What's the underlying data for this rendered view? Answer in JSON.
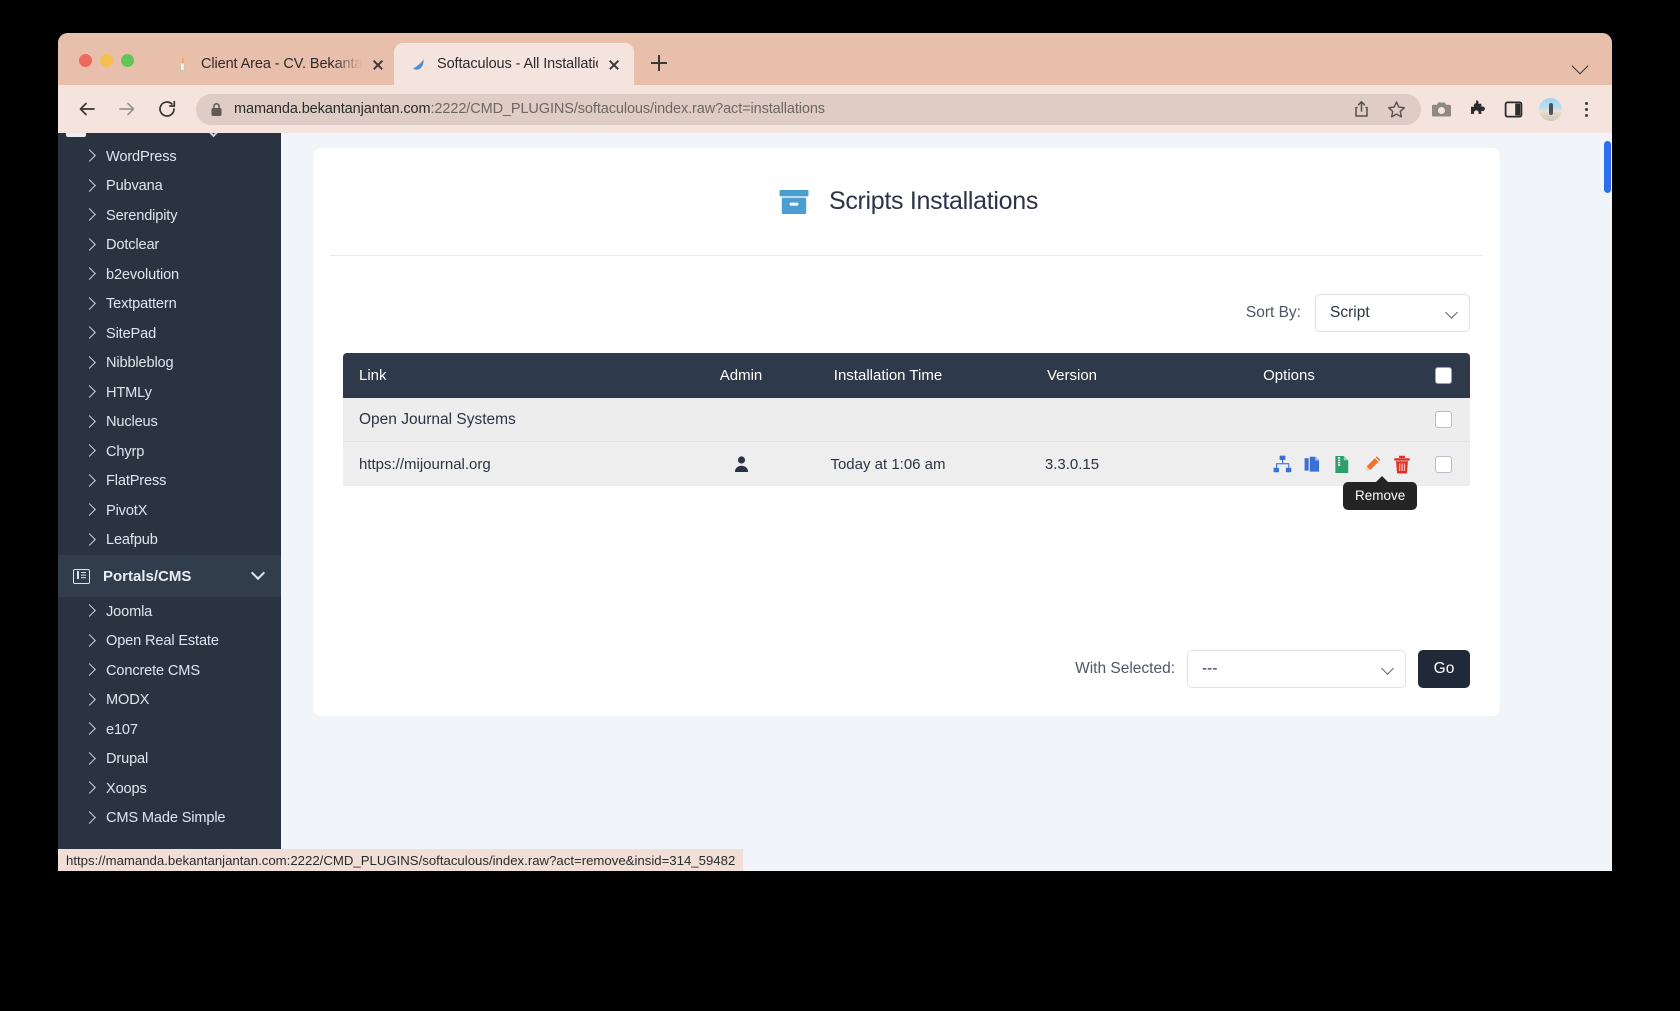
{
  "browser": {
    "tabs": [
      {
        "title": "Client Area - CV. Bekantan Jan",
        "favicon": "candle-icon",
        "active": false
      },
      {
        "title": "Softaculous - All Installations",
        "favicon": "softaculous-icon",
        "active": true
      }
    ],
    "new_tab_label": "+",
    "url_host": "mamanda.bekantanjantan.com",
    "url_rest": ":2222/CMD_PLUGINS/softaculous/index.raw?act=installations",
    "toolbar_icons": [
      "back-arrow-icon",
      "forward-arrow-icon",
      "reload-icon",
      "lock-icon",
      "share-icon",
      "bookmark-star-icon",
      "screenshot-camera-icon",
      "extensions-puzzle-icon",
      "side-panel-icon",
      "profile-avatar",
      "kebab-menu-icon"
    ],
    "status_url": "https://mamanda.bekantanjantan.com:2222/CMD_PLUGINS/softaculous/index.raw?act=remove&insid=314_59482"
  },
  "sidebar": {
    "items": [
      {
        "label": "WordPress"
      },
      {
        "label": "Pubvana"
      },
      {
        "label": "Serendipity"
      },
      {
        "label": "Dotclear"
      },
      {
        "label": "b2evolution"
      },
      {
        "label": "Textpattern"
      },
      {
        "label": "SitePad"
      },
      {
        "label": "Nibbleblog"
      },
      {
        "label": "HTMLy"
      },
      {
        "label": "Nucleus"
      },
      {
        "label": "Chyrp"
      },
      {
        "label": "FlatPress"
      },
      {
        "label": "PivotX"
      },
      {
        "label": "Leafpub"
      }
    ],
    "group": {
      "label": "Portals/CMS",
      "icon": "list-box-icon",
      "expanded": true
    },
    "group_items": [
      {
        "label": "Joomla"
      },
      {
        "label": "Open Real Estate"
      },
      {
        "label": "Concrete CMS"
      },
      {
        "label": "MODX"
      },
      {
        "label": "e107"
      },
      {
        "label": "Drupal"
      },
      {
        "label": "Xoops"
      },
      {
        "label": "CMS Made Simple"
      }
    ]
  },
  "main": {
    "title": "Scripts Installations",
    "title_icon": "archive-box-icon",
    "sort": {
      "label": "Sort By:",
      "value": "Script"
    },
    "table": {
      "headers": [
        "Link",
        "Admin",
        "Installation Time",
        "Version",
        "Options",
        ""
      ],
      "group_row": {
        "name": "Open Journal Systems"
      },
      "rows": [
        {
          "link": "https://mijournal.org",
          "admin_icon": "user-person-icon",
          "installation_time": "Today at 1:06 am",
          "version": "3.3.0.15",
          "options": [
            "sitemap-icon",
            "clone-copy-icon",
            "backup-zip-icon",
            "edit-pencil-icon",
            "remove-trash-icon"
          ]
        }
      ]
    },
    "tooltip": "Remove",
    "with_selected": {
      "label": "With Selected:",
      "value": "---",
      "go_label": "Go"
    }
  },
  "colors": {
    "sidebar_bg": "#2a3441",
    "table_header_bg": "#2e3a49",
    "accent_blue": "#4a9ed0",
    "icon_blue": "#3b6fd4",
    "icon_green": "#2e9e6b",
    "icon_orange": "#f0722a",
    "icon_red": "#e03226",
    "browser_chrome": "#f5e4dd",
    "tab_strip": "#e8bfab",
    "scrollbar_thumb": "#2b6ef0"
  }
}
